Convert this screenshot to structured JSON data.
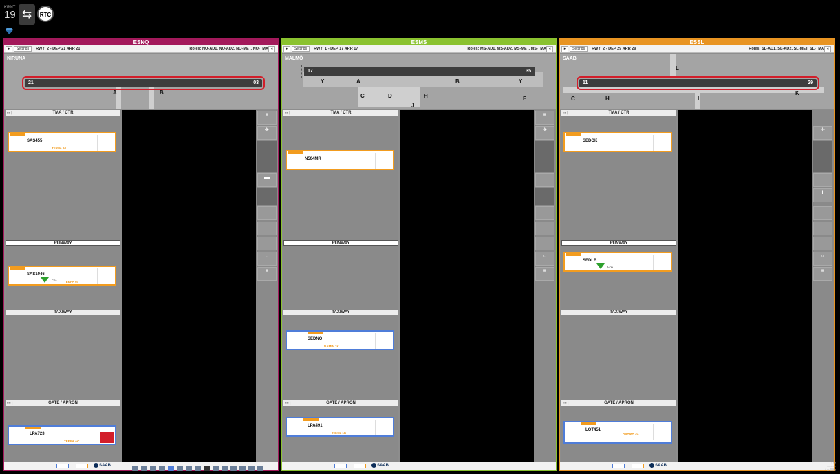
{
  "topbar": {
    "clock_label": "KRNT",
    "clock_value": "19",
    "swap_icon": "swap-arrows-icon",
    "rtc_label": "RTC"
  },
  "colors": {
    "esnq": "#a3195b",
    "esms": "#8ac22f",
    "essl": "#e89422",
    "strip_orange": "#f29c1f",
    "strip_blue": "#4f7dd9"
  },
  "panels": [
    {
      "id": "ESNQ",
      "title": "ESNQ",
      "settings_label": "Settings",
      "runway_info": "RWY: 2 - DEP 21 ARR 21",
      "roles": "Roles: NQ-AD1, NQ-AD2, NQ-MET, NQ-TMA",
      "city": "KIRUNA",
      "rwy_left": "21",
      "rwy_right": "03",
      "taxiways": [
        "A",
        "B"
      ],
      "bays": {
        "tma": "TMA / CTR",
        "runway": "RUNWAY",
        "taxiway": "TAXIWAY",
        "gate": "GATE / APRON"
      },
      "strips": [
        {
          "callsign": "SAS455",
          "note": "TERPA 94"
        },
        {
          "callsign": "SAS1046",
          "note": "TERPA 94",
          "cfa": "CFA"
        },
        {
          "callsign": "LPA723",
          "note": "TERPA AC"
        }
      ]
    },
    {
      "id": "ESMS",
      "title": "ESMS",
      "settings_label": "Settings",
      "runway_info": "RWY: 1 - DEP 17 ARR 17",
      "roles": "Roles: MS-AD1, MS-AD2, MS-MET, MS-TMA",
      "city": "MALMÖ",
      "rwy_left": "17",
      "rwy_right": "35",
      "taxiways": [
        "Y",
        "A",
        "B",
        "Y",
        "C",
        "D",
        "H",
        "J",
        "E"
      ],
      "bays": {
        "tma": "TMA / CTR",
        "runway": "RUNWAY",
        "taxiway": "TAXIWAY",
        "gate": "GATE / APRON"
      },
      "strips": [
        {
          "callsign": "N504MR",
          "note": ""
        },
        {
          "callsign": "SEDNO",
          "note": "NAMIN 1K"
        },
        {
          "callsign": "LPA491",
          "note": "NEXIL 1K"
        }
      ]
    },
    {
      "id": "ESSL",
      "title": "ESSL",
      "settings_label": "Settings",
      "runway_info": "RWY: 2 - DEP 29 ARR 29",
      "roles": "Roles: SL-AD1, SL-AD2, SL-MET, SL-TMA",
      "city": "SAAB",
      "rwy_left": "11",
      "rwy_right": "29",
      "taxiways": [
        "L",
        "C",
        "H",
        "I",
        "K"
      ],
      "bays": {
        "tma": "TMA / CTR",
        "runway": "RUNWAY",
        "taxiway": "TAXIWAY",
        "gate": "GATE / APRON"
      },
      "strips": [
        {
          "callsign": "SEDOK",
          "note": ""
        },
        {
          "callsign": "SEDLB",
          "note": "",
          "cfa": "CFA"
        },
        {
          "callsign": "LOT451",
          "note": "ABAMA 1C"
        }
      ]
    }
  ],
  "footer": {
    "brand": "SAAB"
  }
}
